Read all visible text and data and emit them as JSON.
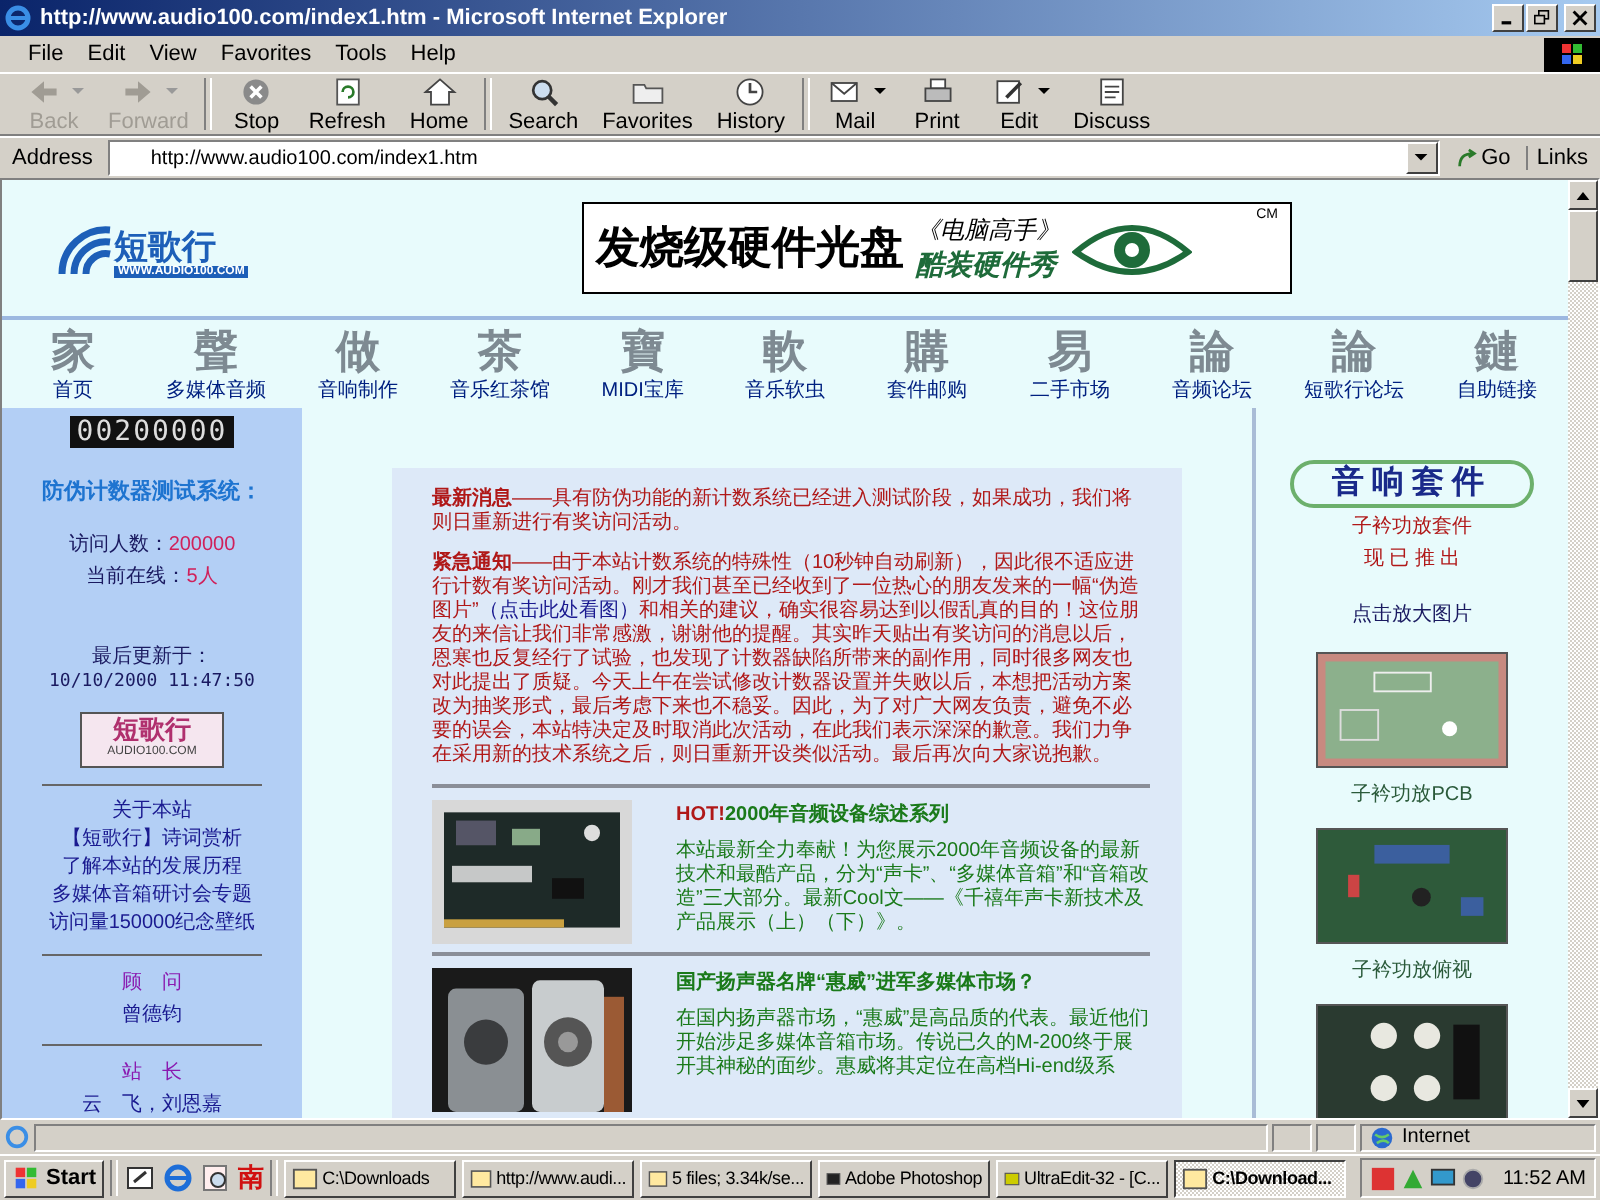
{
  "window": {
    "title": "http://www.audio100.com/index1.htm - Microsoft Internet Explorer"
  },
  "menu": [
    "File",
    "Edit",
    "View",
    "Favorites",
    "Tools",
    "Help"
  ],
  "toolbar": [
    {
      "kind": "back",
      "label": "Back",
      "disabled": true,
      "dropdown": true
    },
    {
      "kind": "forward",
      "label": "Forward",
      "disabled": true,
      "dropdown": true
    },
    {
      "kind": "stop",
      "label": "Stop",
      "disabled": false,
      "dropdown": false
    },
    {
      "kind": "refresh",
      "label": "Refresh",
      "disabled": false,
      "dropdown": false
    },
    {
      "kind": "home",
      "label": "Home",
      "disabled": false,
      "dropdown": false
    },
    {
      "kind": "search",
      "label": "Search",
      "disabled": false,
      "dropdown": false
    },
    {
      "kind": "favorites",
      "label": "Favorites",
      "disabled": false,
      "dropdown": false
    },
    {
      "kind": "history",
      "label": "History",
      "disabled": false,
      "dropdown": false
    },
    {
      "kind": "mail",
      "label": "Mail",
      "disabled": false,
      "dropdown": true
    },
    {
      "kind": "print",
      "label": "Print",
      "disabled": false,
      "dropdown": false
    },
    {
      "kind": "edit",
      "label": "Edit",
      "disabled": false,
      "dropdown": true
    },
    {
      "kind": "discuss",
      "label": "Discuss",
      "disabled": false,
      "dropdown": false
    }
  ],
  "address": {
    "label": "Address",
    "value": "http://www.audio100.com/index1.htm",
    "go": "Go",
    "links": "Links"
  },
  "header": {
    "logo_text": "短歌行",
    "logo_url": "WWW.AUDIO100.COM",
    "banner": {
      "headline": "发烧级硬件光盘",
      "magazine": "《电脑高手》",
      "product": "酷装硬件秀",
      "mark": "CM"
    }
  },
  "nav": [
    {
      "glyph": "家",
      "label": "首页"
    },
    {
      "glyph": "聲",
      "label": "多媒体音频"
    },
    {
      "glyph": "做",
      "label": "音响制作"
    },
    {
      "glyph": "茶",
      "label": "音乐红茶馆"
    },
    {
      "glyph": "寶",
      "label": "MIDI宝库"
    },
    {
      "glyph": "軟",
      "label": "音乐软虫"
    },
    {
      "glyph": "購",
      "label": "套件邮购"
    },
    {
      "glyph": "易",
      "label": "二手市场"
    },
    {
      "glyph": "論",
      "label": "音频论坛"
    },
    {
      "glyph": "論",
      "label": "短歌行论坛"
    },
    {
      "glyph": "鏈",
      "label": "自助链接"
    }
  ],
  "left": {
    "counter": "00200000",
    "title": "防伪计数器测试系统：",
    "visits_label": "访问人数：",
    "visits_value": "200000",
    "online_label": "当前在线：",
    "online_value": "5人",
    "updated_label": "最后更新于：",
    "updated_value": "10/10/2000 11:47:50",
    "badge": {
      "text": "短歌行",
      "url": "AUDIO100.COM"
    },
    "links": [
      "关于本站",
      "【短歌行】诗词赏析",
      "了解本站的发展历程",
      "多媒体音箱研讨会专题",
      "访问量150000纪念壁纸"
    ],
    "advisor_title": "顾　问",
    "advisor_name": "曾德钧",
    "admin_title": "站　长",
    "admin_names": "云　飞，刘恩嘉"
  },
  "news": [
    {
      "parts": [
        {
          "kind": "lead",
          "text": "最新消息"
        },
        {
          "kind": "plain",
          "text": "——具有防伪功能的新计数系统已经进入测试阶段，如果成功，我们将则日重新进行有奖访问活动。"
        }
      ]
    },
    {
      "parts": [
        {
          "kind": "lead",
          "text": "紧急通知"
        },
        {
          "kind": "plain",
          "text": "——由于本站计数系统的特殊性（10秒钟自动刷新），因此很不适应进行计数有奖访问活动。刚才我们甚至已经收到了一位热心的朋友发来的一幅“伪造图片”"
        },
        {
          "kind": "link",
          "text": "（点击此处看图）"
        },
        {
          "kind": "plain",
          "text": "和相关的建议，确实很容易达到以假乱真的目的！这位朋友的来信让我们非常感激，谢谢他的提醒。其实昨天贴出有奖访问的消息以后，恩寒也反复经行了试验，也发现了计数器缺陷所带来的副作用，同时很多网友也对此提出了质疑。今天上午在尝试修改计数器设置并失败以后，本想把活动方案改为抽奖形式，最后考虑下来也不稳妥。因此，为了对广大网友负责，避免不必要的误会，本站特决定及时取消此次活动，在此我们表示深深的歉意。我们力争在采用新的技术系统之后，则日重新开设类似活动。最后再次向大家说抱歉。"
        }
      ]
    }
  ],
  "articles": [
    {
      "hot": "HOT!",
      "title": "2000年音频设备综述系列",
      "text": "本站最新全力奉献！为您展示2000年音频设备的最新技术和最酷产品，分为“声卡”、“多媒体音箱”和“音箱改造”三大部分。最新Cool文——《千禧年声卡新技术及产品展示（上）（下）》。"
    },
    {
      "title": "国产扬声器名牌“惠威”进军多媒体市场？",
      "text": "在国内扬声器市场，“惠威”是高品质的代表。最近他们开始涉足多媒体音箱市场。传说已久的M-200终于展开其神秘的面纱。惠威将其定位在高档Hi-end级系"
    }
  ],
  "right": {
    "heading": "音响套件",
    "lines": [
      "子衿功放套件",
      "现 已 推 出"
    ],
    "click_text": "点击放大图片",
    "captions": [
      "子衿功放PCB",
      "子衿功放俯视"
    ]
  },
  "status": {
    "zone": "Internet"
  },
  "taskbar": {
    "start": "Start",
    "quick": [
      "南"
    ],
    "tasks": [
      {
        "label": "C:\\Downloads",
        "selected": false
      },
      {
        "label": "http://www.audi...",
        "selected": false
      },
      {
        "label": "5 files; 3.34k/se...",
        "selected": false
      },
      {
        "label": "Adobe Photoshop",
        "selected": false
      },
      {
        "label": "UltraEdit-32 - [C...",
        "selected": false
      },
      {
        "label": "C:\\Download...",
        "selected": true
      }
    ],
    "time": "11:52 AM"
  }
}
